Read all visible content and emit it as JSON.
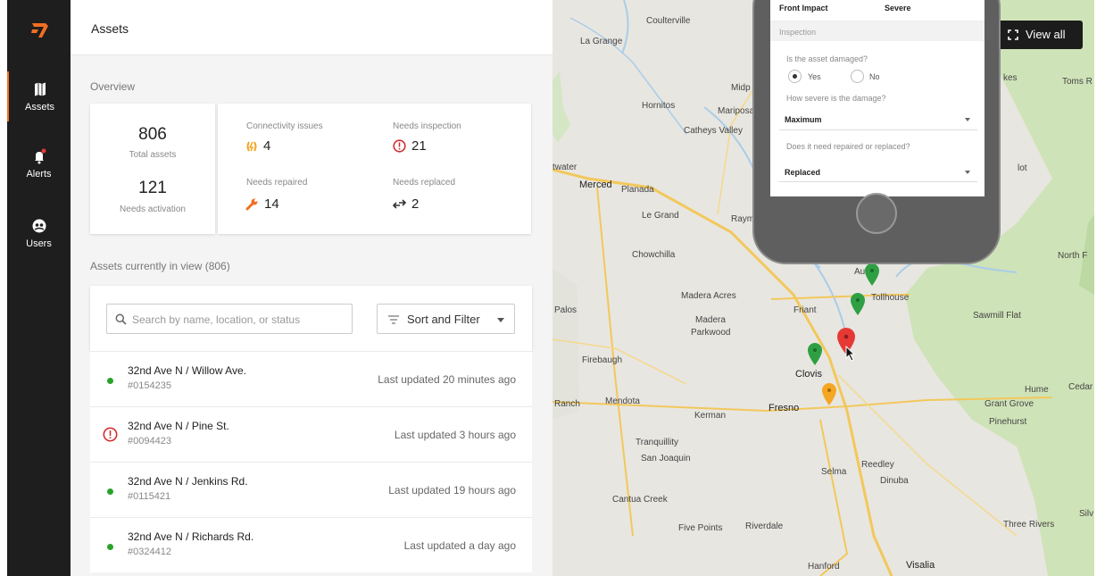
{
  "sidebar": {
    "items": [
      {
        "label": "Assets",
        "icon": "map-icon",
        "active": true
      },
      {
        "label": "Alerts",
        "icon": "bell-icon",
        "active": false
      },
      {
        "label": "Users",
        "icon": "users-icon",
        "active": false
      }
    ],
    "accent": "#f26f21"
  },
  "panel": {
    "title": "Assets",
    "overview_label": "Overview",
    "total_assets": "806",
    "total_assets_label": "Total assets",
    "needs_activation": "121",
    "needs_activation_label": "Needs activation",
    "connectivity_label": "Connectivity issues",
    "connectivity_value": "4",
    "inspection_label": "Needs inspection",
    "inspection_value": "21",
    "repaired_label": "Needs repaired",
    "repaired_value": "14",
    "replaced_label": "Needs replaced",
    "replaced_value": "2",
    "in_view_label": "Assets currently in view (806)",
    "search_placeholder": "Search by name, location, or status",
    "sort_label": "Sort and Filter"
  },
  "assets": [
    {
      "name": "32nd Ave N / Willow Ave.",
      "id": "#0154235",
      "updated": "Last updated 20 minutes ago",
      "status": "ok"
    },
    {
      "name": "32nd Ave N / Pine St.",
      "id": "#0094423",
      "updated": "Last updated 3 hours ago",
      "status": "alert"
    },
    {
      "name": "32nd Ave N / Jenkins Rd.",
      "id": "#0115421",
      "updated": "Last updated 19 hours ago",
      "status": "ok"
    },
    {
      "name": "32nd Ave N / Richards Rd.",
      "id": "#0324412",
      "updated": "Last updated a day ago",
      "status": "ok"
    }
  ],
  "map": {
    "view_all": "View all",
    "places": {
      "coulterville": "Coulterville",
      "la_grange": "La Grange",
      "hornitos": "Hornitos",
      "mariposa": "Mariposa",
      "midpines": "Midp",
      "catheys_valley": "Catheys Valley",
      "toms": "Toms R",
      "merced": "Merced",
      "planada": "Planada",
      "le_grand": "Le Grand",
      "atwater": "twater",
      "raymond": "Raym",
      "chowchilla": "Chowchilla",
      "madera_acres": "Madera Acres",
      "madera": "Madera",
      "parkwood": "Parkwood",
      "palos": "Palos",
      "friant": "Friant",
      "tollhouse": "Tollhouse",
      "auberry": "Au",
      "sawmill_flat": "Sawmill Flat",
      "north_fork": "North F",
      "firebaugh": "Firebaugh",
      "clovis": "Clovis",
      "ranch": "Ranch",
      "mendota": "Mendota",
      "kerman": "Kerman",
      "fresno": "Fresno",
      "hume": "Hume",
      "cedar": "Cedar",
      "grant_grove": "Grant Grove",
      "pinehurst": "Pinehurst",
      "tranquillity": "Tranquillity",
      "san_joaquin": "San Joaquin",
      "reedley": "Reedley",
      "selma": "Selma",
      "dinuba": "Dinuba",
      "cantua_creek": "Cantua Creek",
      "five_points": "Five Points",
      "riverdale": "Riverdale",
      "three_rivers": "Three Rivers",
      "hanford": "Hanford",
      "visalia": "Visalia",
      "silv": "Silv",
      "lot": "lot",
      "kes": "kes"
    }
  },
  "phone": {
    "top_left": "Front Impact",
    "top_right": "Severe",
    "section": "Inspection",
    "q1": "Is the asset damaged?",
    "yes": "Yes",
    "no": "No",
    "q2": "How severe is the damage?",
    "severity": "Maximum",
    "q3": "Does it need repaired or replaced?",
    "action": "Replaced"
  }
}
